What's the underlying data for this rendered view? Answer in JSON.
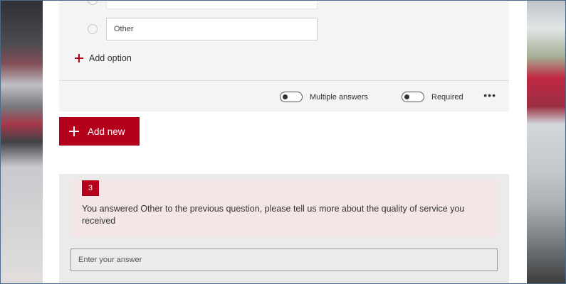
{
  "question2": {
    "options": [
      {
        "value": ""
      },
      {
        "value": "Other"
      }
    ],
    "add_option_label": "Add option",
    "multiple_answers_label": "Multiple answers",
    "required_label": "Required",
    "more_label": "•••"
  },
  "add_new_label": "Add new",
  "question3": {
    "number": "3",
    "title": "You answered Other to the previous question, please tell us more about the quality of service you received",
    "answer_placeholder": "Enter your answer"
  },
  "colors": {
    "accent": "#b4001a",
    "question_header_bg": "#f4e6e6",
    "card_bg": "#f4f4f4"
  }
}
